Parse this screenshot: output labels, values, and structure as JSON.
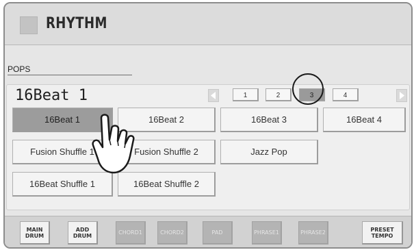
{
  "header": {
    "title": "RHYTHM",
    "icon": "rhythm-square-icon"
  },
  "category": "POPS",
  "selected_rhythm": "16Beat 1",
  "pager": {
    "prev_icon": "arrow-left-icon",
    "next_icon": "arrow-right-icon",
    "pages": [
      {
        "label": "1",
        "active": false
      },
      {
        "label": "2",
        "active": false
      },
      {
        "label": "3",
        "active": true
      },
      {
        "label": "4",
        "active": false
      }
    ]
  },
  "rhythms": [
    {
      "label": "16Beat 1",
      "selected": true
    },
    {
      "label": "16Beat 2",
      "selected": false
    },
    {
      "label": "16Beat 3",
      "selected": false
    },
    {
      "label": "16Beat 4",
      "selected": false
    },
    {
      "label": "Fusion Shuffle 1",
      "selected": false
    },
    {
      "label": "Fusion Shuffle 2",
      "selected": false
    },
    {
      "label": "Jazz Pop",
      "selected": false
    },
    {
      "label": "16Beat Shuffle 1",
      "selected": false
    },
    {
      "label": "16Beat Shuffle 2",
      "selected": false
    }
  ],
  "bottom_buttons": [
    {
      "label": "MAIN\nDRUM",
      "enabled": true
    },
    {
      "label": "ADD\nDRUM",
      "enabled": true
    },
    {
      "label": "CHORD1",
      "enabled": false
    },
    {
      "label": "CHORD2",
      "enabled": false
    },
    {
      "label": "PAD",
      "enabled": false
    },
    {
      "label": "PHRASE1",
      "enabled": false
    },
    {
      "label": "PHRASE2",
      "enabled": false
    },
    {
      "label": "PRESET\nTEMPO",
      "enabled": true
    }
  ],
  "overlay": {
    "hand_icon": "pointing-hand-icon",
    "highlight": "page-3-circle"
  },
  "colors": {
    "selected_button": "#9c9c9c",
    "disabled_button": "#b4b4b4",
    "background": "#e6e6e6"
  }
}
